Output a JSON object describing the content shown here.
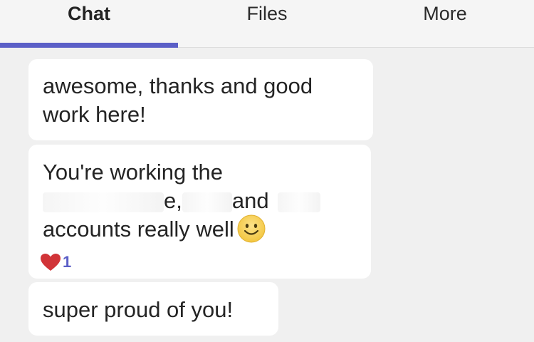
{
  "tabs": [
    {
      "label": "Chat",
      "active": true
    },
    {
      "label": "Files",
      "active": false
    },
    {
      "label": "More",
      "active": false
    }
  ],
  "messages": [
    {
      "lines": [
        "awesome, thanks and good",
        "work here!"
      ]
    },
    {
      "line1": "You're working the",
      "line2_a": "e,",
      "line2_b": "and",
      "line3": "accounts really well",
      "emoji": "smiley-emoji",
      "reaction": {
        "icon": "heart-icon",
        "count": "1",
        "color": "#d13438"
      }
    },
    {
      "lines": [
        "super proud of you!"
      ]
    }
  ],
  "colors": {
    "accent": "#5b5fc7",
    "heart": "#d13438",
    "background": "#f0f0f0",
    "bubble": "#ffffff"
  }
}
